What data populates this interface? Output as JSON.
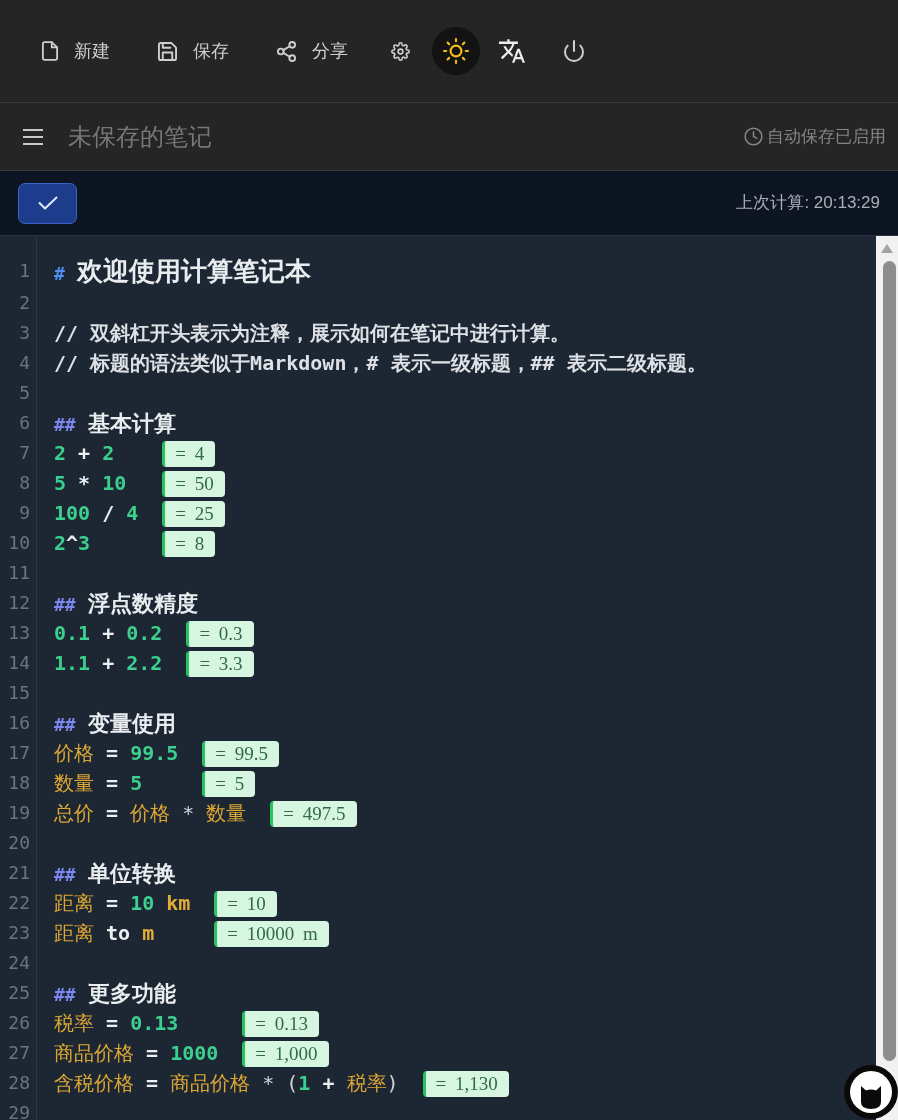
{
  "toolbar": {
    "buttons": [
      {
        "kind": "new",
        "label": "新建",
        "hovered": false
      },
      {
        "kind": "save",
        "label": "保存",
        "hovered": false
      },
      {
        "kind": "share",
        "label": "分享",
        "hovered": false
      },
      {
        "kind": "settings",
        "hovered": false
      },
      {
        "kind": "theme",
        "hovered": true
      },
      {
        "kind": "language",
        "hovered": false
      },
      {
        "kind": "power",
        "hovered": false
      }
    ]
  },
  "title_bar": {
    "title": "未保存的笔记",
    "autosave_status": "自动保存已启用"
  },
  "action_bar": {
    "last_calculated": "上次计算: 20:13:29"
  },
  "editor": {
    "lines": [
      {
        "number": "1",
        "kind": "heading1",
        "marker": "#",
        "text": "欢迎使用计算笔记本"
      },
      {
        "number": "2",
        "kind": "blank"
      },
      {
        "number": "3",
        "kind": "comment",
        "text": "// 双斜杠开头表示为注释，展示如何在笔记中进行计算。"
      },
      {
        "number": "4",
        "kind": "comment",
        "text": "// 标题的语法类似于Markdown，# 表示一级标题，## 表示二级标题。"
      },
      {
        "number": "5",
        "kind": "blank"
      },
      {
        "number": "6",
        "kind": "heading2",
        "marker": "##",
        "text": "基本计算"
      },
      {
        "kind": "calc_group",
        "lines": [
          {
            "number": "7",
            "tokens": [
              {
                "kind": "number",
                "text": "2"
              },
              {
                "kind": "operator",
                "text": " +"
              },
              {
                "kind": "number",
                "text": " 2"
              }
            ],
            "result": "= 4"
          },
          {
            "number": "8",
            "tokens": [
              {
                "kind": "number",
                "text": "5"
              },
              {
                "kind": "operator",
                "text": " *"
              },
              {
                "kind": "number",
                "text": " 10"
              }
            ],
            "result": "= 50"
          },
          {
            "number": "9",
            "tokens": [
              {
                "kind": "number",
                "text": "100"
              },
              {
                "kind": "operator",
                "text": " /"
              },
              {
                "kind": "number",
                "text": " 4"
              }
            ],
            "result": "= 25"
          },
          {
            "number": "10",
            "tokens": [
              {
                "kind": "number",
                "text": "2"
              },
              {
                "kind": "operator",
                "text": "^"
              },
              {
                "kind": "number",
                "text": "3"
              }
            ],
            "result": "= 8"
          }
        ]
      },
      {
        "number": "11",
        "kind": "blank"
      },
      {
        "number": "12",
        "kind": "heading2",
        "marker": "##",
        "text": "浮点数精度"
      },
      {
        "kind": "calc_group",
        "lines": [
          {
            "number": "13",
            "tokens": [
              {
                "kind": "number",
                "text": "0.1"
              },
              {
                "kind": "operator",
                "text": " +"
              },
              {
                "kind": "number",
                "text": " 0.2"
              }
            ],
            "result": "= 0.3"
          },
          {
            "number": "14",
            "tokens": [
              {
                "kind": "number",
                "text": "1.1"
              },
              {
                "kind": "operator",
                "text": " +"
              },
              {
                "kind": "number",
                "text": " 2.2"
              }
            ],
            "result": "= 3.3"
          }
        ]
      },
      {
        "number": "15",
        "kind": "blank"
      },
      {
        "number": "16",
        "kind": "heading2",
        "marker": "##",
        "text": "变量使用"
      },
      {
        "kind": "calc_group",
        "lines": [
          {
            "number": "17",
            "tokens": [
              {
                "kind": "variable",
                "text": "价格"
              },
              {
                "kind": "operator",
                "text": " ="
              },
              {
                "kind": "number",
                "text": " 99.5"
              }
            ],
            "result": "= 99.5"
          },
          {
            "number": "18",
            "tokens": [
              {
                "kind": "variable",
                "text": "数量"
              },
              {
                "kind": "operator",
                "text": " ="
              },
              {
                "kind": "number",
                "text": " 5"
              }
            ],
            "result": "= 5"
          }
        ]
      },
      {
        "kind": "calc_group",
        "lines": [
          {
            "number": "19",
            "tokens": [
              {
                "kind": "variable",
                "text": "总价"
              },
              {
                "kind": "operator",
                "text": " ="
              },
              {
                "kind": "variable",
                "text": " 价格"
              },
              {
                "kind": "punctuation",
                "text": " *"
              },
              {
                "kind": "variable",
                "text": " 数量"
              }
            ],
            "result": "= 497.5"
          }
        ]
      },
      {
        "number": "20",
        "kind": "blank"
      },
      {
        "number": "21",
        "kind": "heading2",
        "marker": "##",
        "text": "单位转换"
      },
      {
        "kind": "calc_group",
        "lines": [
          {
            "number": "22",
            "tokens": [
              {
                "kind": "variable",
                "text": "距离"
              },
              {
                "kind": "operator",
                "text": " ="
              },
              {
                "kind": "number",
                "text": " 10"
              },
              {
                "kind": "unit",
                "text": " km"
              }
            ],
            "result": "= 10"
          },
          {
            "number": "23",
            "tokens": [
              {
                "kind": "variable",
                "text": "距离"
              },
              {
                "kind": "keyword",
                "text": " to"
              },
              {
                "kind": "unit",
                "text": " m"
              }
            ],
            "result": "= 10000 m"
          }
        ]
      },
      {
        "number": "24",
        "kind": "blank"
      },
      {
        "number": "25",
        "kind": "heading2",
        "marker": "##",
        "text": "更多功能"
      },
      {
        "kind": "calc_group",
        "lines": [
          {
            "number": "26",
            "tokens": [
              {
                "kind": "variable",
                "text": "税率"
              },
              {
                "kind": "operator",
                "text": " ="
              },
              {
                "kind": "number",
                "text": " 0.13"
              }
            ],
            "result": "= 0.13"
          },
          {
            "number": "27",
            "tokens": [
              {
                "kind": "variable",
                "text": "商品价格"
              },
              {
                "kind": "operator",
                "text": " ="
              },
              {
                "kind": "number",
                "text": " 1000"
              }
            ],
            "result": "= 1,000"
          }
        ]
      },
      {
        "kind": "calc_group",
        "lines": [
          {
            "number": "28",
            "tokens": [
              {
                "kind": "variable",
                "text": "含税价格"
              },
              {
                "kind": "operator",
                "text": " ="
              },
              {
                "kind": "variable",
                "text": " 商品价格"
              },
              {
                "kind": "punctuation",
                "text": " *"
              },
              {
                "kind": "punctuation",
                "text": " ("
              },
              {
                "kind": "number",
                "text": "1"
              },
              {
                "kind": "operator",
                "text": " +"
              },
              {
                "kind": "variable",
                "text": " 税率"
              },
              {
                "kind": "punctuation",
                "text": ")"
              }
            ],
            "result": "= 1,130"
          }
        ]
      },
      {
        "number": "29",
        "kind": "blank"
      }
    ]
  }
}
